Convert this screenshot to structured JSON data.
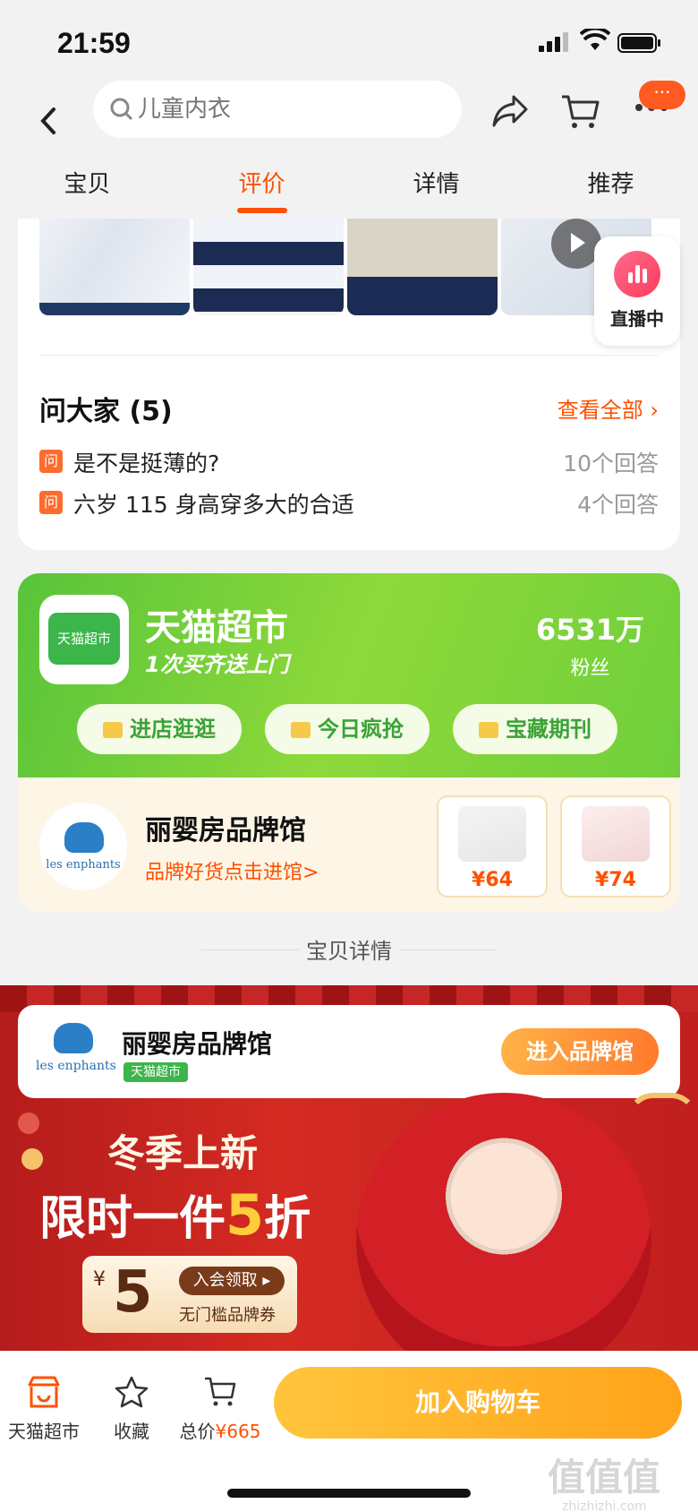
{
  "status": {
    "time": "21:59"
  },
  "nav": {
    "search_placeholder": "儿童内衣",
    "msg_badge": "···"
  },
  "tabs": [
    {
      "label": "宝贝"
    },
    {
      "label": "评价"
    },
    {
      "label": "详情"
    },
    {
      "label": "推荐"
    }
  ],
  "review": {
    "live_label": "直播中"
  },
  "qa": {
    "title": "问大家 (5)",
    "view_all": "查看全部 ›",
    "icon_char": "问",
    "items": [
      {
        "question": "是不是挺薄的?",
        "answers": "10个回答"
      },
      {
        "question": "六岁 115 身高穿多大的合适",
        "answers": "4个回答"
      }
    ]
  },
  "tmall": {
    "logo_text": "天猫超市",
    "name": "天猫超市",
    "slogan": "1次买齐送上门",
    "fans_count": "6531万",
    "fans_label": "粉丝",
    "pills": [
      "进店逛逛",
      "今日疯抢",
      "宝藏期刊"
    ]
  },
  "brand": {
    "logo_text": "les enphants",
    "name": "丽婴房品牌馆",
    "link": "品牌好货点击进馆>",
    "products": [
      {
        "price": "¥64"
      },
      {
        "price": "¥74"
      }
    ]
  },
  "section_title": "宝贝详情",
  "banner": {
    "logo_text": "les enphants",
    "brand_name": "丽婴房品牌馆",
    "tag": "天猫超市",
    "enter": "进入品牌馆",
    "headline1": "冬季上新",
    "headline2a": "限时一件",
    "headline2b": "5",
    "headline2c": "折",
    "coupon_currency": "¥",
    "coupon_value": "5",
    "coupon_get": "入会领取 ▸",
    "coupon_sub": "无门槛品牌券"
  },
  "bottom": {
    "items": [
      {
        "label": "天猫超市"
      },
      {
        "label": "收藏"
      }
    ],
    "total_label": "总价",
    "total_price": "¥665",
    "add_to_cart": "加入购物车"
  },
  "watermark": {
    "main": "值值值",
    "url": "zhizhizhi.com"
  },
  "colors": {
    "accent": "#ff5000",
    "tmall_green": "#58c43a",
    "cart_button": "#ffa31a"
  }
}
